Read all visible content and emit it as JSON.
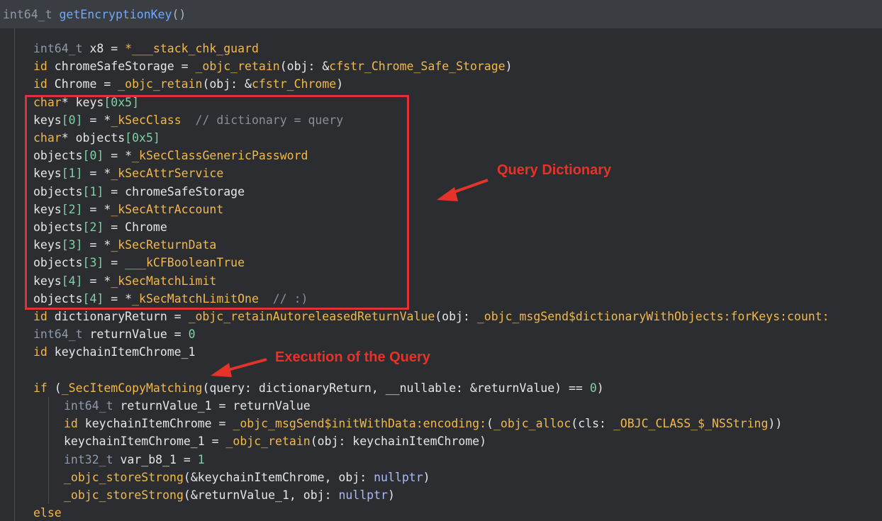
{
  "header": {
    "signature": "int64_t getEncryptionKey()",
    "ret_type": "int64_t",
    "func_name": "getEncryptionKey",
    "parens": "()"
  },
  "annotations": {
    "query_dictionary": "Query Dictionary",
    "execution_of_query": "Execution of the Query"
  },
  "colors": {
    "highlight_box": "#e0313a",
    "annotation_text": "#e5332a"
  },
  "code_lines": [
    [
      [
        "t",
        "int64_t"
      ],
      [
        "p",
        " x8 = "
      ],
      [
        "f",
        "*___stack_chk_guard"
      ]
    ],
    [
      [
        "k",
        "id"
      ],
      [
        "p",
        " chromeSafeStorage = "
      ],
      [
        "f",
        "_objc_retain"
      ],
      [
        "p",
        "(obj: &"
      ],
      [
        "f",
        "cfstr_Chrome_Safe_Storage"
      ],
      [
        "p",
        ")"
      ]
    ],
    [
      [
        "k",
        "id"
      ],
      [
        "p",
        " Chrome = "
      ],
      [
        "f",
        "_objc_retain"
      ],
      [
        "p",
        "(obj: &"
      ],
      [
        "f",
        "cfstr_Chrome"
      ],
      [
        "p",
        ")"
      ]
    ],
    [
      [
        "k",
        "char"
      ],
      [
        "p",
        "* keys"
      ],
      [
        "n",
        "[0x5]"
      ]
    ],
    [
      [
        "p",
        "keys"
      ],
      [
        "n",
        "[0]"
      ],
      [
        "p",
        " = *"
      ],
      [
        "f",
        "_kSecClass"
      ],
      [
        "c",
        "  // dictionary = query"
      ]
    ],
    [
      [
        "k",
        "char"
      ],
      [
        "p",
        "* objects"
      ],
      [
        "n",
        "[0x5]"
      ]
    ],
    [
      [
        "p",
        "objects"
      ],
      [
        "n",
        "[0]"
      ],
      [
        "p",
        " = *"
      ],
      [
        "f",
        "_kSecClassGenericPassword"
      ]
    ],
    [
      [
        "p",
        "keys"
      ],
      [
        "n",
        "[1]"
      ],
      [
        "p",
        " = *"
      ],
      [
        "f",
        "_kSecAttrService"
      ]
    ],
    [
      [
        "p",
        "objects"
      ],
      [
        "n",
        "[1]"
      ],
      [
        "p",
        " = chromeSafeStorage"
      ]
    ],
    [
      [
        "p",
        "keys"
      ],
      [
        "n",
        "[2]"
      ],
      [
        "p",
        " = *"
      ],
      [
        "f",
        "_kSecAttrAccount"
      ]
    ],
    [
      [
        "p",
        "objects"
      ],
      [
        "n",
        "[2]"
      ],
      [
        "p",
        " = Chrome"
      ]
    ],
    [
      [
        "p",
        "keys"
      ],
      [
        "n",
        "[3]"
      ],
      [
        "p",
        " = *"
      ],
      [
        "f",
        "_kSecReturnData"
      ]
    ],
    [
      [
        "p",
        "objects"
      ],
      [
        "n",
        "[3]"
      ],
      [
        "p",
        " = "
      ],
      [
        "f",
        "___kCFBooleanTrue"
      ]
    ],
    [
      [
        "p",
        "keys"
      ],
      [
        "n",
        "[4]"
      ],
      [
        "p",
        " = *"
      ],
      [
        "f",
        "_kSecMatchLimit"
      ]
    ],
    [
      [
        "p",
        "objects"
      ],
      [
        "n",
        "[4]"
      ],
      [
        "p",
        " = *"
      ],
      [
        "f",
        "_kSecMatchLimitOne"
      ],
      [
        "c",
        "  // :)"
      ]
    ],
    [
      [
        "k",
        "id"
      ],
      [
        "p",
        " dictionaryReturn = "
      ],
      [
        "f",
        "_objc_retainAutoreleasedReturnValue"
      ],
      [
        "p",
        "(obj: "
      ],
      [
        "f",
        "_objc_msgSend$dictionaryWithObjects:forKeys:count:"
      ]
    ],
    [
      [
        "t",
        "int64_t"
      ],
      [
        "p",
        " returnValue = "
      ],
      [
        "n",
        "0"
      ]
    ],
    [
      [
        "k",
        "id"
      ],
      [
        "p",
        " keychainItemChrome_1"
      ]
    ],
    [],
    [
      [
        "k",
        "if"
      ],
      [
        "p",
        " ("
      ],
      [
        "f",
        "_SecItemCopyMatching"
      ],
      [
        "p",
        "(query: dictionaryReturn, __nullable: &returnValue) == "
      ],
      [
        "n",
        "0"
      ],
      [
        "p",
        ")"
      ]
    ],
    [
      [
        "t",
        "int64_t"
      ],
      [
        "p",
        " returnValue_1 = returnValue"
      ]
    ],
    [
      [
        "k",
        "id"
      ],
      [
        "p",
        " keychainItemChrome = "
      ],
      [
        "f",
        "_objc_msgSend$initWithData:encoding:"
      ],
      [
        "p",
        "("
      ],
      [
        "f",
        "_objc_alloc"
      ],
      [
        "p",
        "(cls: "
      ],
      [
        "f",
        "_OBJC_CLASS_$_NSString"
      ],
      [
        "p",
        "))"
      ]
    ],
    [
      [
        "p",
        "keychainItemChrome_1 = "
      ],
      [
        "f",
        "_objc_retain"
      ],
      [
        "p",
        "(obj: keychainItemChrome)"
      ]
    ],
    [
      [
        "t",
        "int32_t"
      ],
      [
        "p",
        " var_b8_1 = "
      ],
      [
        "n",
        "1"
      ]
    ],
    [
      [
        "f",
        "_objc_storeStrong"
      ],
      [
        "p",
        "(&keychainItemChrome, obj: "
      ],
      [
        "l",
        "nullptr"
      ],
      [
        "p",
        ")"
      ]
    ],
    [
      [
        "f",
        "_objc_storeStrong"
      ],
      [
        "p",
        "(&returnValue_1, obj: "
      ],
      [
        "l",
        "nullptr"
      ],
      [
        "p",
        ")"
      ]
    ],
    [
      [
        "k",
        "else"
      ]
    ]
  ]
}
